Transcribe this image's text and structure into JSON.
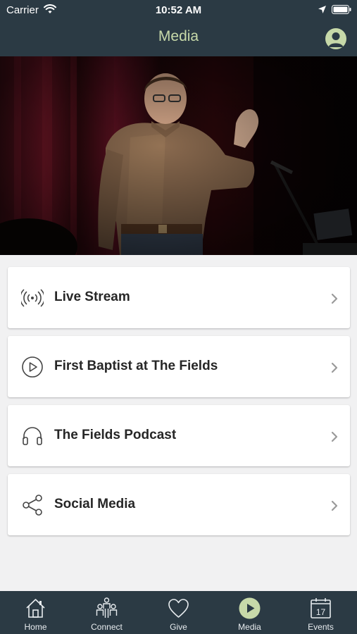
{
  "status_bar": {
    "carrier": "Carrier",
    "time": "10:52 AM"
  },
  "nav": {
    "title": "Media",
    "profile_icon": "user-circle-icon"
  },
  "colors": {
    "bar_background": "#2b3a44",
    "accent": "#c7d9a9",
    "page_background": "#f1f1f2",
    "card_background": "#ffffff"
  },
  "menu": {
    "items": [
      {
        "label": "Live Stream",
        "icon": "broadcast-icon"
      },
      {
        "label": "First Baptist at The Fields",
        "icon": "play-circle-icon"
      },
      {
        "label": "The Fields Podcast",
        "icon": "headphones-icon"
      },
      {
        "label": "Social Media",
        "icon": "share-icon"
      }
    ]
  },
  "tabs": {
    "items": [
      {
        "label": "Home",
        "icon": "home-icon",
        "active": false
      },
      {
        "label": "Connect",
        "icon": "people-icon",
        "active": false
      },
      {
        "label": "Give",
        "icon": "heart-icon",
        "active": false
      },
      {
        "label": "Media",
        "icon": "play-circle-icon",
        "active": true
      },
      {
        "label": "Events",
        "icon": "calendar-icon",
        "active": false,
        "calendar_day": "17"
      }
    ]
  }
}
